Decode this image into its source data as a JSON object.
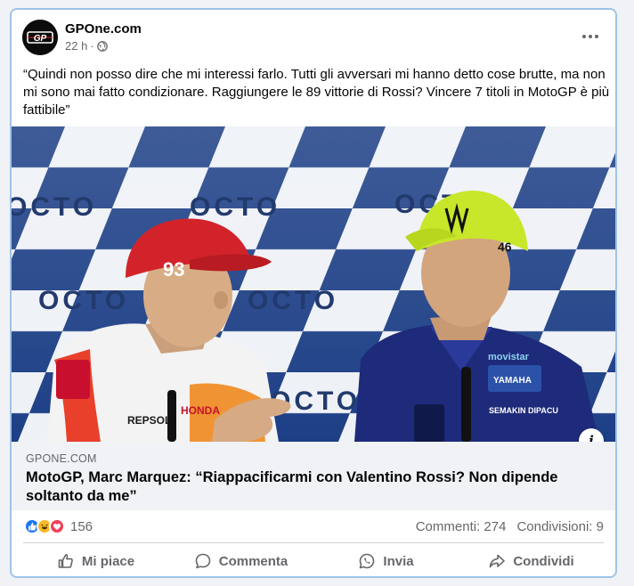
{
  "post": {
    "page_name": "GPOne.com",
    "time": "22 h",
    "separator": "·",
    "privacy_icon": "globe-icon",
    "avatar_text": "GP",
    "text": "“Quindi non posso dire che mi interessi farlo. Tutti gli avversari mi hanno detto cose brutte, ma non mi sono mai fatto condizionare. Raggiungere le 89 vittorie di Rossi? Vincere 7 titoli in MotoGP è più fattibile”"
  },
  "media": {
    "backdrop_text": "OCTO",
    "rider_left_cap_number": "93",
    "rider_left_sponsor": "HONDA",
    "rider_left_sponsor_2": "REPSOL",
    "rider_right_cap_number": "46",
    "rider_right_sponsor": "YAMAHA",
    "rider_right_sponsor_2": "SEMAKIN DIPACU",
    "rider_right_sponsor_3": "movistar",
    "info_label": "i"
  },
  "link": {
    "domain": "GPONE.COM",
    "title": "MotoGP, Marc Marquez: “Riappacificarmi con Valentino Rossi? Non dipende soltanto da me”"
  },
  "stats": {
    "reaction_count": "156",
    "comments": "Commenti: 274",
    "shares": "Condivisioni: 9"
  },
  "actions": {
    "like": "Mi piace",
    "comment": "Commenta",
    "send": "Invia",
    "share": "Condividi"
  },
  "colors": {
    "like_blue": "#1877f2",
    "haha_yellow": "#f7b928",
    "love_red": "#f33e58",
    "card_border": "#9fc3e8"
  }
}
